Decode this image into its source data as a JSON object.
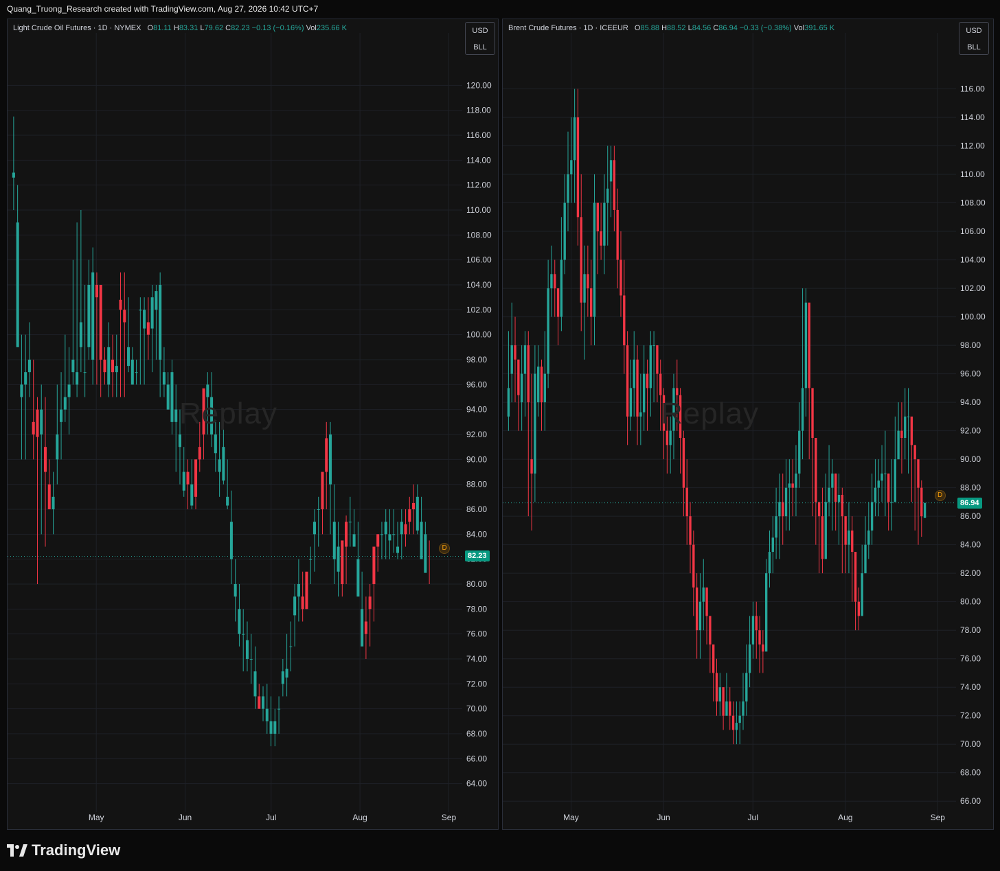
{
  "header": {
    "attribution": "Quang_Truong_Research created with TradingView.com, Aug 27, 2026 10:42 UTC+7"
  },
  "footer": {
    "brand": "TradingView",
    "logo_icon": "tradingview-logo-icon"
  },
  "colors": {
    "up": "#26a69a",
    "down": "#f23645",
    "grid": "#1e2127",
    "axis_text": "#d1d4dc",
    "price_tag": "#089981"
  },
  "chart_data": [
    {
      "type": "candlestick",
      "legend": {
        "title": "Light Crude Oil Futures · 1D · NYMEX",
        "o_label": "O",
        "o": "81.11",
        "h_label": "H",
        "h": "83.31",
        "l_label": "L",
        "l": "79.62",
        "c_label": "C",
        "c": "82.23",
        "change": "−0.13 (−0.16%)",
        "vol_label": "Vol",
        "vol": "235.66 K"
      },
      "units": [
        "USD",
        "BLL"
      ],
      "last_price": "82.23",
      "marker": "D",
      "watermark": "Replay",
      "ylim": [
        62,
        122
      ],
      "y_ticks": [
        "64.00",
        "66.00",
        "68.00",
        "70.00",
        "72.00",
        "74.00",
        "76.00",
        "78.00",
        "80.00",
        "82.00",
        "84.00",
        "86.00",
        "88.00",
        "90.00",
        "92.00",
        "94.00",
        "96.00",
        "98.00",
        "100.00",
        "102.00",
        "104.00",
        "106.00",
        "108.00",
        "110.00",
        "112.00",
        "114.00",
        "116.00",
        "118.00",
        "120.00"
      ],
      "x_ticks": [
        {
          "label": "May",
          "day": 30
        },
        {
          "label": "Jun",
          "day": 61
        },
        {
          "label": "Jul",
          "day": 91
        },
        {
          "label": "Aug",
          "day": 122
        },
        {
          "label": "Sep",
          "day": 153
        }
      ],
      "closes": [
        113,
        109,
        96,
        97,
        98,
        92,
        91.8,
        94,
        89,
        86,
        87,
        92,
        94,
        95,
        96,
        98,
        97,
        101,
        97,
        104,
        105,
        103,
        98,
        97,
        99,
        97,
        97.5,
        102,
        101,
        99,
        98,
        97,
        102,
        102,
        100,
        103,
        103.5,
        104,
        97,
        96,
        97,
        94,
        92,
        89,
        88,
        88,
        87,
        90,
        92,
        96,
        95,
        92,
        90,
        91,
        87,
        85,
        80,
        78,
        76,
        75.5,
        74,
        73,
        70,
        71,
        70,
        69,
        69,
        70,
        73,
        73.2,
        75,
        79,
        80,
        78,
        78,
        82,
        85,
        86,
        86,
        89,
        92,
        85,
        83,
        80,
        83,
        85,
        84,
        82,
        78,
        76,
        78,
        80,
        83,
        84,
        85,
        84,
        84,
        83,
        85,
        84,
        85,
        86,
        87,
        85,
        84,
        82.23
      ],
      "opens": [
        112.6,
        99,
        95,
        96,
        97,
        93,
        94,
        92,
        91,
        88,
        86,
        90,
        93,
        94,
        95,
        97,
        96,
        99,
        97,
        99,
        98,
        104,
        104,
        98,
        96,
        98,
        97,
        102.8,
        102,
        97.5,
        96,
        97,
        102,
        100.5,
        101,
        100.5,
        102,
        98,
        96,
        94,
        93,
        93,
        91,
        87.5,
        89,
        86.3,
        90,
        91,
        95.7,
        95,
        92,
        90.5,
        89,
        88.3,
        86.3,
        82,
        79,
        76,
        76,
        74,
        74,
        71,
        71,
        70,
        69,
        68,
        68,
        70,
        72,
        72.5,
        75,
        77.5,
        79,
        79,
        81,
        82,
        84,
        86,
        89,
        91.7,
        88,
        82,
        81,
        83.5,
        85,
        85,
        83,
        79,
        75,
        77,
        79,
        83,
        84,
        84,
        84,
        83.5,
        84,
        82.5,
        84,
        84.8,
        86,
        86.5,
        84.3,
        82,
        80.9
      ],
      "highs": [
        117.5,
        112,
        100,
        100,
        101,
        98,
        95,
        96,
        95,
        90,
        89,
        96,
        97,
        100,
        99,
        106,
        109,
        110,
        104,
        106,
        107,
        105,
        99,
        99,
        101,
        100,
        100,
        105,
        105,
        103,
        99,
        98,
        103,
        103,
        103,
        104,
        104,
        105,
        99,
        97,
        98,
        96,
        94,
        91,
        90,
        90,
        88.5,
        93,
        95,
        97,
        97,
        93,
        93,
        93,
        90,
        87.5,
        82,
        80,
        78,
        77,
        76,
        75,
        72,
        71.8,
        72,
        71,
        70,
        71,
        74,
        76,
        77,
        80,
        82,
        81,
        80,
        83,
        86,
        87,
        88,
        93,
        93,
        88,
        85,
        82,
        85.5,
        87,
        86,
        85,
        81,
        79,
        80,
        82,
        84,
        85,
        86,
        86,
        86,
        85,
        86,
        86,
        87,
        88,
        88,
        87,
        85,
        83.5
      ],
      "lows": [
        110,
        102,
        90,
        90,
        95,
        90,
        80,
        84,
        83,
        86,
        84,
        88,
        90,
        93,
        92,
        96,
        95,
        97,
        95,
        98,
        96,
        96,
        95,
        96,
        95,
        95,
        95,
        95,
        95,
        97,
        96,
        96,
        96,
        96,
        98,
        97,
        98,
        95,
        95,
        94,
        92,
        89,
        88,
        87,
        86,
        86,
        86,
        89,
        90,
        92,
        91,
        89,
        87,
        88,
        86,
        80,
        77,
        75,
        73,
        73,
        72,
        70,
        70,
        69,
        68,
        67,
        67,
        68,
        71,
        71,
        73,
        75,
        77,
        77,
        78,
        80,
        81,
        83,
        84,
        86,
        84,
        80,
        79,
        79,
        80,
        83,
        83,
        80,
        76,
        74,
        75,
        77,
        81,
        82,
        82,
        82,
        82.5,
        82,
        82,
        83,
        84,
        84,
        84,
        83,
        81,
        80
      ],
      "day_start": 0,
      "day_end": 156
    },
    {
      "type": "candlestick",
      "legend": {
        "title": "Brent Crude Futures · 1D · ICEEUR",
        "o_label": "O",
        "o": "85.88",
        "h_label": "H",
        "h": "88.52",
        "l_label": "L",
        "l": "84.56",
        "c_label": "C",
        "c": "86.94",
        "change": "−0.33 (−0.38%)",
        "vol_label": "Vol",
        "vol": "391.65 K"
      },
      "units": [
        "USD",
        "BLL"
      ],
      "last_price": "86.94",
      "marker": "D",
      "watermark": "Replay",
      "ylim": [
        65,
        118
      ],
      "y_ticks": [
        "66.00",
        "68.00",
        "70.00",
        "72.00",
        "74.00",
        "76.00",
        "78.00",
        "80.00",
        "82.00",
        "84.00",
        "86.00",
        "88.00",
        "90.00",
        "92.00",
        "94.00",
        "96.00",
        "98.00",
        "100.00",
        "102.00",
        "104.00",
        "106.00",
        "108.00",
        "110.00",
        "112.00",
        "114.00",
        "116.00"
      ],
      "x_ticks": [
        {
          "label": "May",
          "day": 22
        },
        {
          "label": "Jun",
          "day": 53
        },
        {
          "label": "Jul",
          "day": 83
        },
        {
          "label": "Aug",
          "day": 114
        },
        {
          "label": "Sep",
          "day": 145
        }
      ],
      "closes": [
        95,
        98,
        97,
        94.5,
        96,
        98,
        94,
        89,
        96,
        96.5,
        94,
        96,
        102,
        103,
        102,
        100,
        104,
        108,
        110,
        111,
        114,
        107,
        101,
        103,
        102,
        100,
        108,
        106,
        105,
        108,
        109,
        111,
        107.5,
        104,
        101.5,
        98,
        93,
        95,
        97,
        93,
        93.3,
        96,
        95,
        98,
        98,
        96,
        94.5,
        92,
        91,
        92,
        95,
        94.5,
        91.5,
        88,
        86,
        84,
        81,
        78,
        80,
        81,
        79,
        77,
        75,
        73,
        74,
        72,
        73,
        72,
        71,
        71.5,
        72,
        73,
        75,
        77,
        79,
        78,
        77,
        76.5,
        82,
        83.5,
        84.5,
        86,
        87,
        86,
        88,
        88.3,
        88,
        89,
        92,
        95,
        101,
        95,
        91.5,
        87,
        86,
        83,
        87,
        88,
        89,
        87,
        87.5,
        86,
        84,
        85,
        83.5,
        80,
        79,
        82,
        84,
        85,
        87,
        88,
        88.5,
        89,
        89,
        87,
        87,
        90,
        92,
        91.5,
        93,
        93,
        91,
        90,
        88,
        86,
        86.94
      ],
      "opens": [
        93,
        96,
        98,
        97,
        94,
        96,
        98,
        90,
        89,
        94,
        96.5,
        94,
        96,
        102,
        103,
        102,
        100,
        104,
        108,
        110,
        111,
        114,
        107,
        101,
        103,
        102,
        100,
        108,
        106,
        105,
        108,
        109.5,
        111,
        107.5,
        104,
        101.5,
        98,
        93,
        95,
        97,
        93,
        93.3,
        96,
        95,
        98,
        98,
        96,
        94.5,
        92,
        91,
        92,
        95,
        94.5,
        91.5,
        88,
        86,
        84,
        81,
        78,
        80,
        81,
        79,
        77,
        75,
        73,
        74,
        72,
        73,
        72,
        71,
        71.5,
        72,
        73,
        75,
        77,
        79,
        78,
        77,
        76.5,
        82,
        83.5,
        84.5,
        86,
        87,
        86,
        88,
        88.3,
        88,
        89,
        92,
        95,
        101,
        95,
        91.5,
        87,
        86,
        83,
        87,
        88,
        89,
        87,
        87.5,
        86,
        84,
        85,
        83.5,
        80,
        79,
        82,
        84,
        85,
        87,
        88,
        88.5,
        89,
        89,
        87,
        87,
        90,
        92,
        91.5,
        93,
        93,
        91,
        90,
        88,
        85.88
      ],
      "highs": [
        99,
        101,
        100,
        97,
        98,
        99,
        99,
        96,
        98,
        98,
        97,
        99,
        104,
        105,
        104,
        102,
        107,
        110,
        113,
        114,
        116,
        116,
        110,
        105,
        105,
        104,
        110,
        108,
        108,
        110,
        112,
        112,
        112,
        109,
        106,
        104,
        99,
        97,
        99,
        98,
        96,
        98,
        97,
        99,
        99,
        98,
        97,
        95,
        93,
        93,
        96,
        97,
        95,
        92,
        90,
        87,
        85,
        82,
        82,
        83,
        81,
        79,
        77,
        76,
        75,
        74,
        75,
        74,
        73,
        73,
        73,
        75,
        77,
        79,
        80,
        80,
        79,
        78,
        83,
        85,
        86,
        88,
        89,
        89,
        90,
        90,
        90,
        91,
        94,
        102,
        102,
        97,
        93,
        90,
        87,
        88,
        89,
        91,
        90,
        89,
        89,
        88,
        86,
        87,
        86,
        82,
        81,
        84,
        86,
        87,
        89,
        90,
        90,
        91,
        92,
        89,
        90,
        93,
        94,
        94,
        95,
        95,
        92,
        91,
        89,
        88.52
      ],
      "lows": [
        92,
        94,
        94,
        92,
        92,
        93,
        86,
        85,
        87,
        93,
        92,
        92,
        95,
        100,
        100,
        98,
        99,
        103,
        106,
        108,
        108,
        105,
        99,
        97,
        100,
        98,
        98,
        103,
        104,
        103,
        105,
        107,
        106,
        102,
        100,
        96,
        91,
        92,
        93,
        91,
        91,
        92,
        92,
        93,
        94,
        94,
        92,
        90,
        89,
        89,
        90,
        92,
        89,
        86,
        84,
        82,
        79,
        76,
        76,
        78,
        77,
        75,
        73,
        72,
        72,
        71,
        72,
        71,
        70,
        70,
        70,
        71,
        72,
        74,
        76,
        76,
        75,
        75,
        77,
        81,
        82,
        83,
        83,
        84,
        85,
        85,
        86,
        86,
        88,
        90,
        93,
        90,
        86,
        84,
        82,
        82,
        84,
        86,
        85,
        85,
        84,
        82,
        82,
        82,
        80,
        78,
        78,
        79,
        82,
        83,
        84,
        86,
        86,
        87,
        86,
        85,
        85,
        88,
        90,
        89,
        90,
        89,
        87,
        85,
        84,
        84.56
      ],
      "day_start": 0,
      "day_end": 150
    }
  ]
}
